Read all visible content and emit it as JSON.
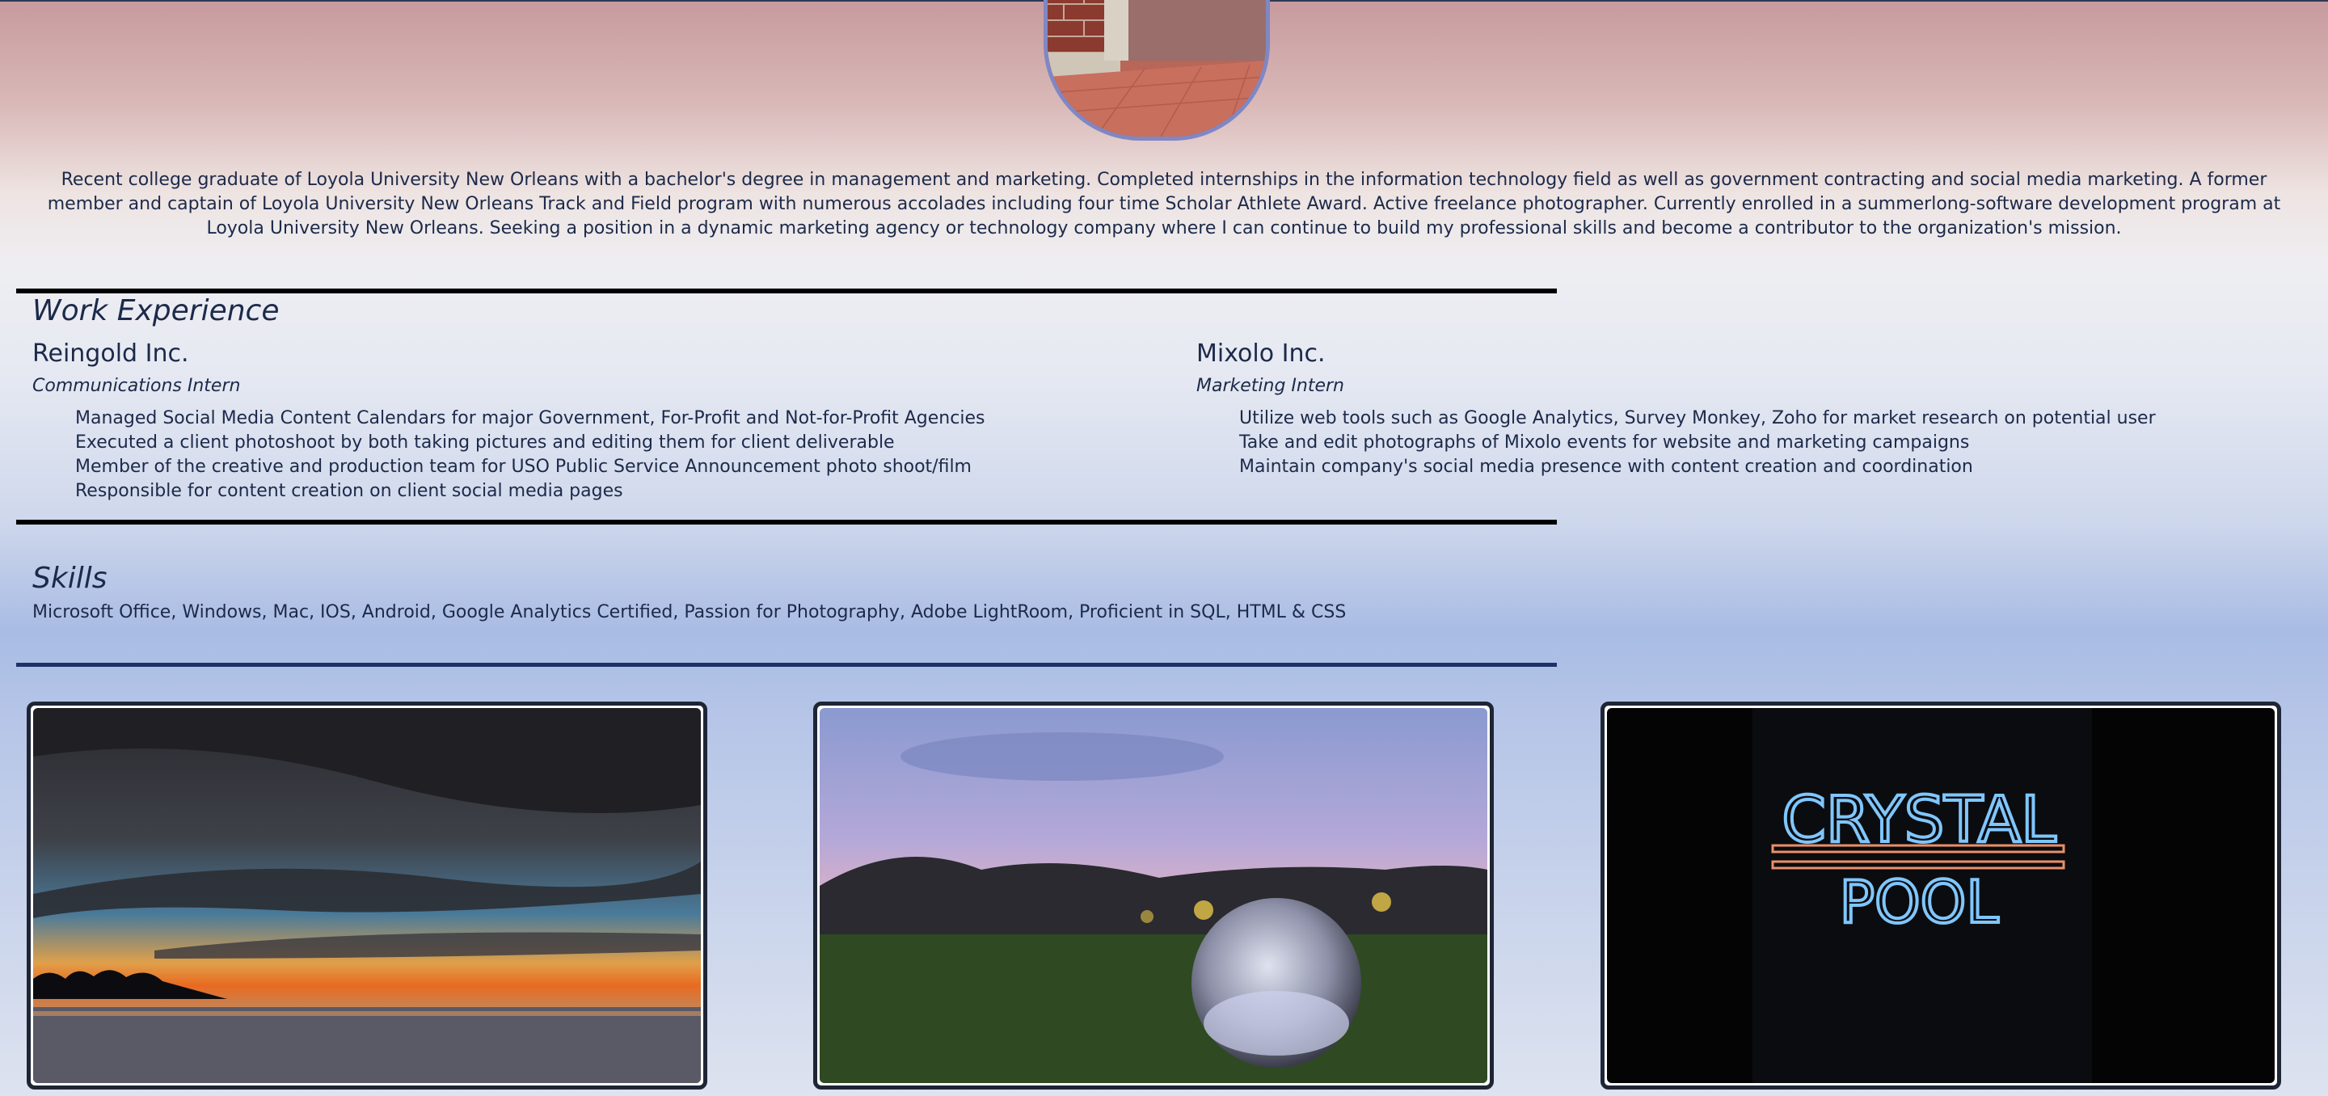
{
  "profile": {
    "summary": "Recent college graduate of Loyola University New Orleans with a bachelor's degree in management and marketing. Completed internships in the information technology field as well as government contracting and social media marketing. A former member and captain of Loyola University New Orleans Track and Field program with numerous accolades including four time Scholar Athlete Award. Active freelance photographer. Currently enrolled in a summerlong-software development program at Loyola University New Orleans. Seeking a position in a dynamic marketing agency or technology company where I can continue to build my professional skills and become a contributor to the organization's mission."
  },
  "work": {
    "title": "Work Experience",
    "jobs": [
      {
        "company": "Reingold Inc.",
        "role": "Communications Intern",
        "duties": [
          "Managed Social Media Content Calendars for major Government, For-Profit and Not-for-Profit Agencies",
          "Executed a client photoshoot by both taking pictures and editing them for client deliverable",
          "Member of the creative and production team for USO Public Service Announcement photo shoot/film",
          "Responsible for content creation on client social media pages"
        ]
      },
      {
        "company": "Mixolo Inc.",
        "role": "Marketing Intern",
        "duties": [
          "Utilize web tools such as Google Analytics, Survey Monkey, Zoho for market research on potential user",
          "Take and edit photographs of Mixolo events for website and marketing campaigns",
          "Maintain company's social media presence with content creation and coordination"
        ]
      }
    ]
  },
  "skills": {
    "title": "Skills",
    "text": "Microsoft Office, Windows, Mac, IOS, Android, Google Analytics Certified, Passion for Photography, Adobe LightRoom, Proficient in SQL, HTML & CSS"
  },
  "gallery": {
    "photo3_sign": {
      "line1": "CRYSTAL",
      "line2": "POOL"
    }
  },
  "colors": {
    "text": "#1c2a4a",
    "rule": "#000000",
    "rule_accent": "#1f3266",
    "frame_border": "#7f87c4"
  }
}
